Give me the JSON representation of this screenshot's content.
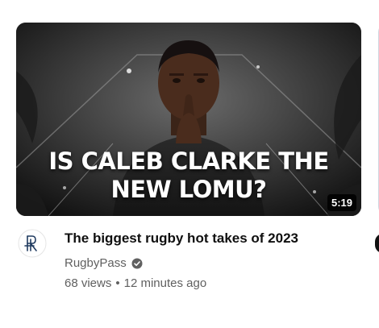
{
  "video": {
    "thumbnail_line1": "IS CALEB CLARKE THE",
    "thumbnail_line2": "NEW LOMU?",
    "duration": "5:19",
    "title": "The biggest rugby hot takes of 2023",
    "channel": "RugbyPass",
    "views": "68 views",
    "separator": "•",
    "age": "12 minutes ago",
    "avatar_icon": "rugbypass-logo-icon",
    "verified_icon": "verified-check-icon"
  },
  "colors": {
    "title": "#0f0f0f",
    "meta": "#606060",
    "duration_bg": "#000000",
    "avatar_logo": "#1f3a5f"
  }
}
